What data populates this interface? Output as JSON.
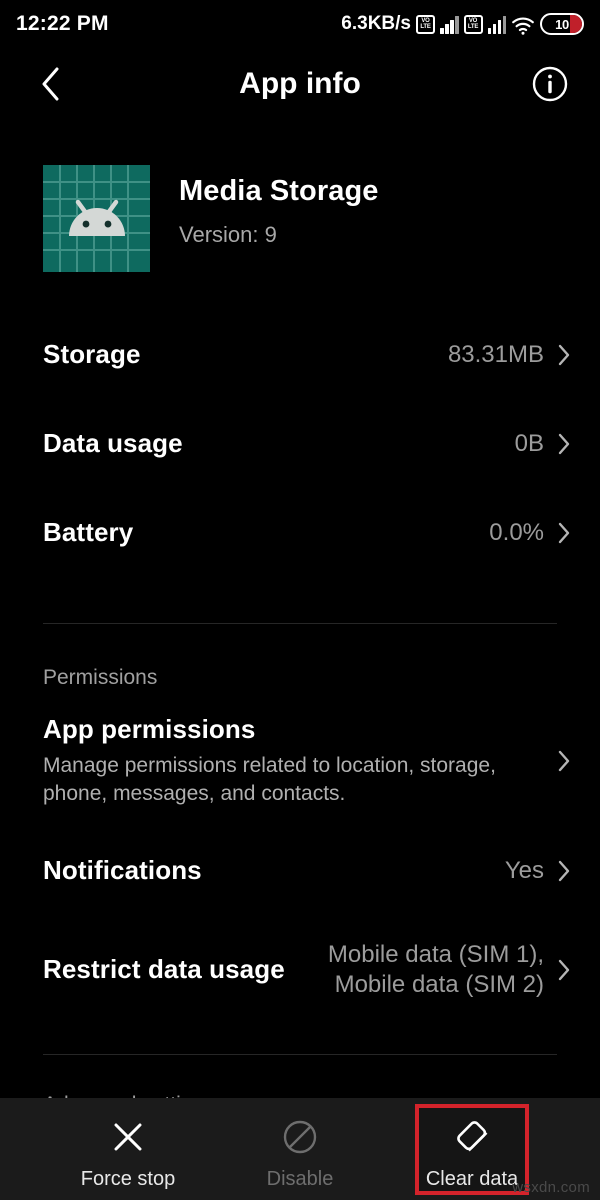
{
  "status_bar": {
    "clock": "12:22 PM",
    "network_speed": "6.3KB/s",
    "volte_top": "VO",
    "volte_bottom": "LTE",
    "sim1_icon": "volte-signal-icon",
    "sim2_icon": "volte-signal-icon",
    "wifi_icon": "wifi-icon",
    "battery_level": "10"
  },
  "app_bar": {
    "back_icon": "chevron-left-icon",
    "title": "App info",
    "info_icon": "info-circle-icon"
  },
  "app_header": {
    "icon_name": "android-robot-icon",
    "icon_bg_color": "#0e6a5f",
    "icon_grid_color": "#3f9186",
    "name": "Media Storage",
    "version": "Version: 9"
  },
  "rows": [
    {
      "title": "Storage",
      "value": "83.31MB",
      "chevron": true
    },
    {
      "title": "Data usage",
      "value": "0B",
      "chevron": true
    },
    {
      "title": "Battery",
      "value": "0.0%",
      "chevron": true
    }
  ],
  "permissions_section": {
    "label": "Permissions",
    "items": [
      {
        "title": "App permissions",
        "subtitle": "Manage permissions related to location, storage, phone, messages, and contacts.",
        "value": "",
        "chevron": true
      },
      {
        "title": "Notifications",
        "subtitle": "",
        "value": "Yes",
        "chevron": true
      },
      {
        "title": "Restrict data usage",
        "subtitle": "",
        "value": "Mobile data (SIM 1),\nMobile data (SIM 2)",
        "chevron": true
      }
    ]
  },
  "advanced_section": {
    "label": "Advanced settings"
  },
  "action_bar": {
    "actions": [
      {
        "label": "Force stop",
        "icon": "close-x-icon",
        "state": "enabled",
        "highlighted": false
      },
      {
        "label": "Disable",
        "icon": "block-circle-icon",
        "state": "disabled",
        "highlighted": false
      },
      {
        "label": "Clear data",
        "icon": "eraser-icon",
        "state": "enabled",
        "highlighted": true
      }
    ],
    "highlight_color": "#d4232b"
  },
  "watermark": "wsxdn.com"
}
